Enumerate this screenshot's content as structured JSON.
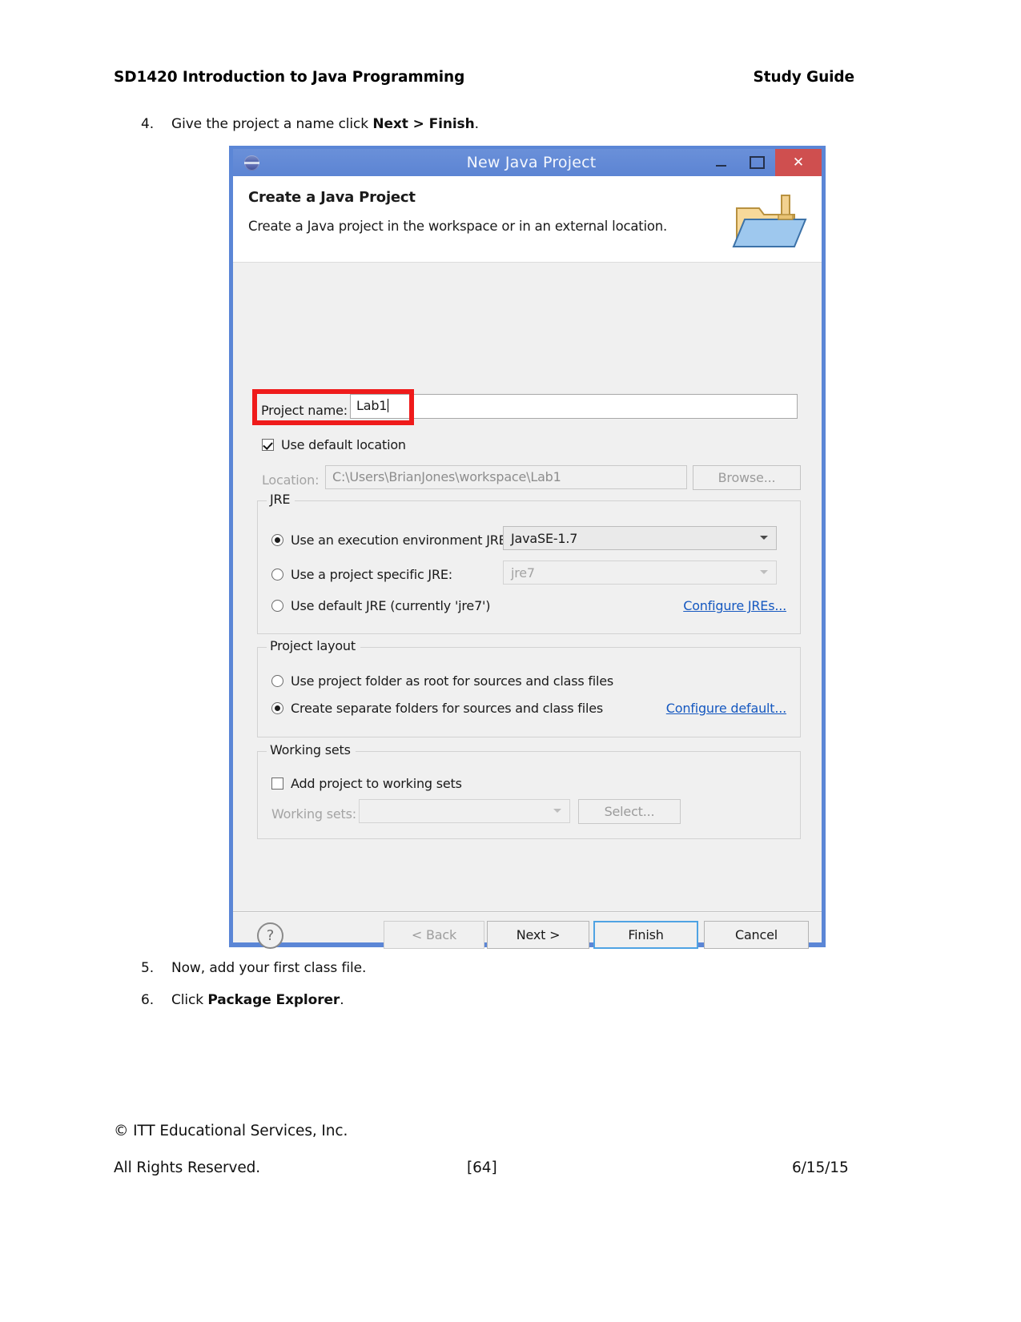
{
  "document": {
    "header_left": "SD1420 Introduction to Java Programming",
    "header_right": "Study Guide",
    "steps": [
      {
        "num": "4.",
        "text_before": "Give the project a name click ",
        "bold": "Next > Finish",
        "text_after": "."
      },
      {
        "num": "5.",
        "text_before": "Now, add your first class file.",
        "bold": "",
        "text_after": ""
      },
      {
        "num": "6.",
        "text_before": "Click ",
        "bold": "Package Explorer",
        "text_after": "."
      }
    ],
    "footer": {
      "copyright": "© ITT Educational Services, Inc.",
      "rights": "All Rights Reserved.",
      "page_number": "[64]",
      "date": "6/15/15"
    }
  },
  "dialog": {
    "title": "New Java Project",
    "window_controls": {
      "minimize": "minimize",
      "maximize": "maximize",
      "close": "✕"
    },
    "wizard": {
      "heading": "Create a Java Project",
      "description": "Create a Java project in the workspace or in an external location."
    },
    "project_name": {
      "label": "Project name:",
      "value": "Lab1"
    },
    "use_default_location": {
      "label": "Use default location",
      "checked": true
    },
    "location": {
      "label": "Location:",
      "value": "C:\\Users\\BrianJones\\workspace\\Lab1",
      "browse_label": "Browse..."
    },
    "jre": {
      "group_title": "JRE",
      "execution_env": {
        "label": "Use an execution environment JRE:",
        "selected": true,
        "value": "JavaSE-1.7"
      },
      "project_specific": {
        "label": "Use a project specific JRE:",
        "selected": false,
        "value": "jre7"
      },
      "default_jre": {
        "label": "Use default JRE (currently 'jre7')",
        "selected": false
      },
      "configure_link": "Configure JREs..."
    },
    "project_layout": {
      "group_title": "Project layout",
      "option_root": {
        "label": "Use project folder as root for sources and class files",
        "selected": false
      },
      "option_separate": {
        "label": "Create separate folders for sources and class files",
        "selected": true
      },
      "configure_link": "Configure default..."
    },
    "working_sets": {
      "group_title": "Working sets",
      "add_checkbox": {
        "label": "Add project to working sets",
        "checked": false
      },
      "field_label": "Working sets:",
      "field_value": "",
      "select_label": "Select..."
    },
    "footer_buttons": {
      "help": "?",
      "back": "< Back",
      "next": "Next >",
      "finish": "Finish",
      "cancel": "Cancel"
    },
    "colors": {
      "title_bar": "#5b86d6",
      "close_button": "#cf4f4f",
      "annotation_box": "#ef1b1b",
      "link": "#1558c0",
      "default_button_border": "#4fa3e3"
    }
  }
}
